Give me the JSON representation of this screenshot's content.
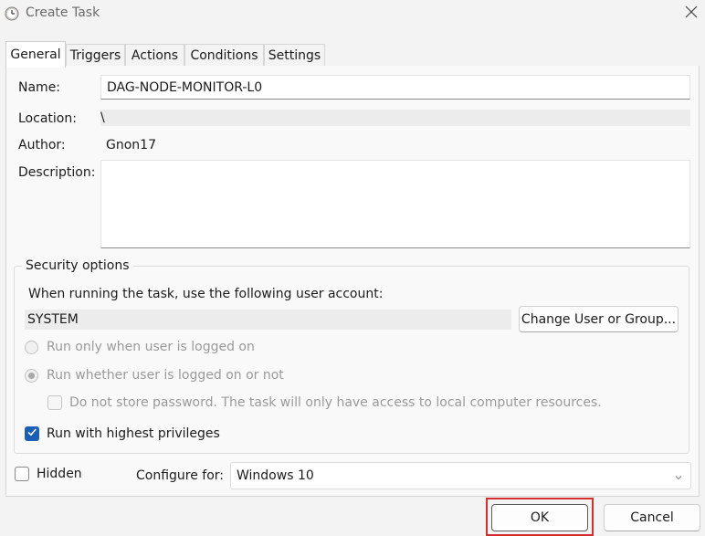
{
  "window": {
    "title": "Create Task"
  },
  "tabs": [
    {
      "label": "General",
      "active": true
    },
    {
      "label": "Triggers",
      "active": false
    },
    {
      "label": "Actions",
      "active": false
    },
    {
      "label": "Conditions",
      "active": false
    },
    {
      "label": "Settings",
      "active": false
    }
  ],
  "general": {
    "name_label": "Name:",
    "name_value": "DAG-NODE-MONITOR-L0",
    "location_label": "Location:",
    "location_value": "\\",
    "author_label": "Author:",
    "author_value": "Gnon17",
    "description_label": "Description:",
    "description_value": ""
  },
  "security": {
    "group_title": "Security options",
    "account_prompt": "When running the task, use the following user account:",
    "account_value": "SYSTEM",
    "change_button": "Change User or Group...",
    "radio_logged_on": "Run only when user is logged on",
    "radio_whether": "Run whether user is logged on or not",
    "no_store_password": "Do not store password.  The task will only have access to local computer resources.",
    "highest_privileges": "Run with highest privileges"
  },
  "footer": {
    "hidden_label": "Hidden",
    "configure_label": "Configure for:",
    "configure_value": "Windows 10",
    "ok_button": "OK",
    "cancel_button": "Cancel"
  },
  "colors": {
    "accent": "#1a5fb4",
    "highlight": "#d32f2f"
  }
}
